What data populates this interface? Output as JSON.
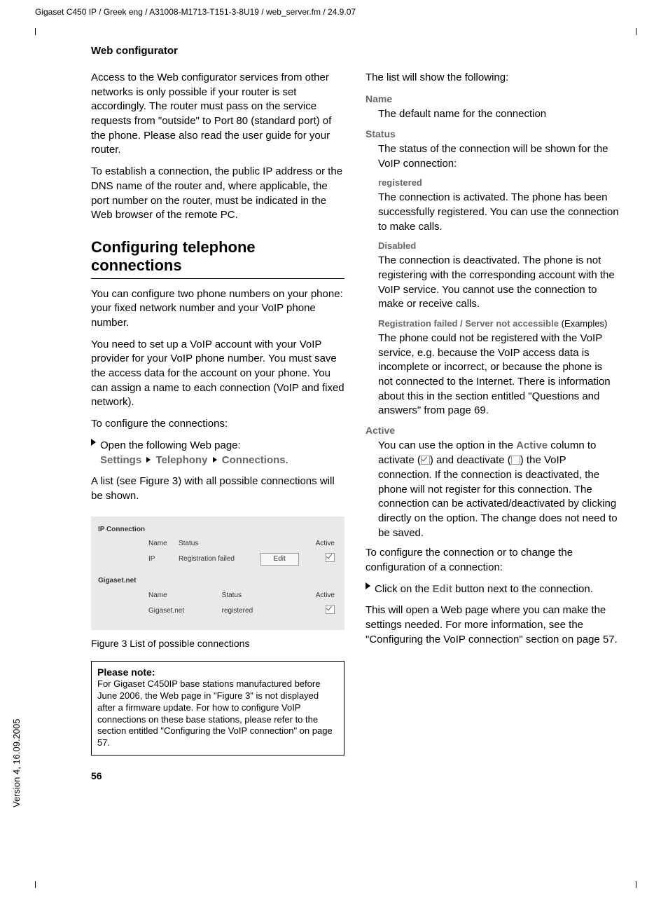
{
  "topline": "Gigaset C450 IP / Greek eng / A31008-M1713-T151-3-8U19 / web_server.fm / 24.9.07",
  "section_title": "Web configurator",
  "left": {
    "p1": "Access to the Web configurator services from other networks is only possible if your router is set accordingly. The router must pass on the service requests from \"outside\" to Port 80 (standard port) of the phone. Please also read the user guide for your router.",
    "p2": "To establish a connection, the public IP address or the DNS name of the router and, where applicable, the port number on the router, must be indicated in the Web browser of the remote PC.",
    "h2": "Configuring telephone connections",
    "p3": "You can configure two phone numbers on your phone: your fixed network number and your VoIP phone number.",
    "p4": "You need to set up a VoIP account with your VoIP provider for your VoIP phone number. You must save the access data for the account on your phone. You can assign a name to each connection (VoIP and fixed network).",
    "p5": "To configure the connections:",
    "li1": "Open the following Web page:",
    "nav": {
      "a": "Settings",
      "b": "Telephony",
      "c": "Connections"
    },
    "p6": "A list (see Figure 3) with all possible connections will be shown.",
    "fig": {
      "sec1": "IP Connection",
      "name": "Name",
      "status": "Status",
      "active": "Active",
      "r1n": "IP",
      "r1s": "Registration failed",
      "edit": "Edit",
      "sec2": "Gigaset.net",
      "r2n": "Gigaset.net",
      "r2s": "registered"
    },
    "figcap": "Figure 3     List of possible connections",
    "note_t": "Please note:",
    "note_b": "For Gigaset C450IP base stations manufactured before June 2006, the Web page in \"Figure 3\" is not displayed after a firmware update. For how to configure VoIP connections on these base stations, please refer to the section entitled \"Configuring the VoIP connection\" on page 57.",
    "pagenum": "56"
  },
  "right": {
    "intro": "The list will show the following:",
    "name_t": "Name",
    "name_b": "The default name for the connection",
    "status_t": "Status",
    "status_b": "The status of the connection will be shown for the VoIP connection:",
    "reg_t": "registered",
    "reg_b": "The connection is activated. The phone has been successfully registered. You can use the connection to make calls.",
    "dis_t": "Disabled",
    "dis_b": "The connection is deactivated. The phone is not registering with the corresponding account with the VoIP service. You cannot use the connection to make or receive calls.",
    "rf_t": "Registration failed / Server not accessible",
    "rf_ex": "(Examples)",
    "rf_b": "The phone could not be registered with the VoIP service, e.g. because the VoIP access data is incomplete or incorrect, or because the phone is not connected to the Internet. There is information about this in the section entitled \"Questions and answers\" from page 69.",
    "active_t": "Active",
    "active_b1": "You can use the option in the ",
    "active_gray": "Active",
    "active_b2": " column to activate (",
    "active_b3": ") and deactivate (",
    "active_b4": ") the VoIP connection. If the connection is deactivated, the phone will not register for this connection. The connection can be activated/deactivated by clicking directly on the option. The change does not need to be saved.",
    "conf": "To configure the connection or to change the configuration of a connection:",
    "li2a": "Click on the ",
    "li2edit": "Edit",
    "li2b": " button next to the connection.",
    "out": "This will open a Web page where you can make the settings needed. For more information, see the \"Configuring the VoIP connection\" section on page 57."
  },
  "sideversion": "Version 4, 16.09.2005"
}
